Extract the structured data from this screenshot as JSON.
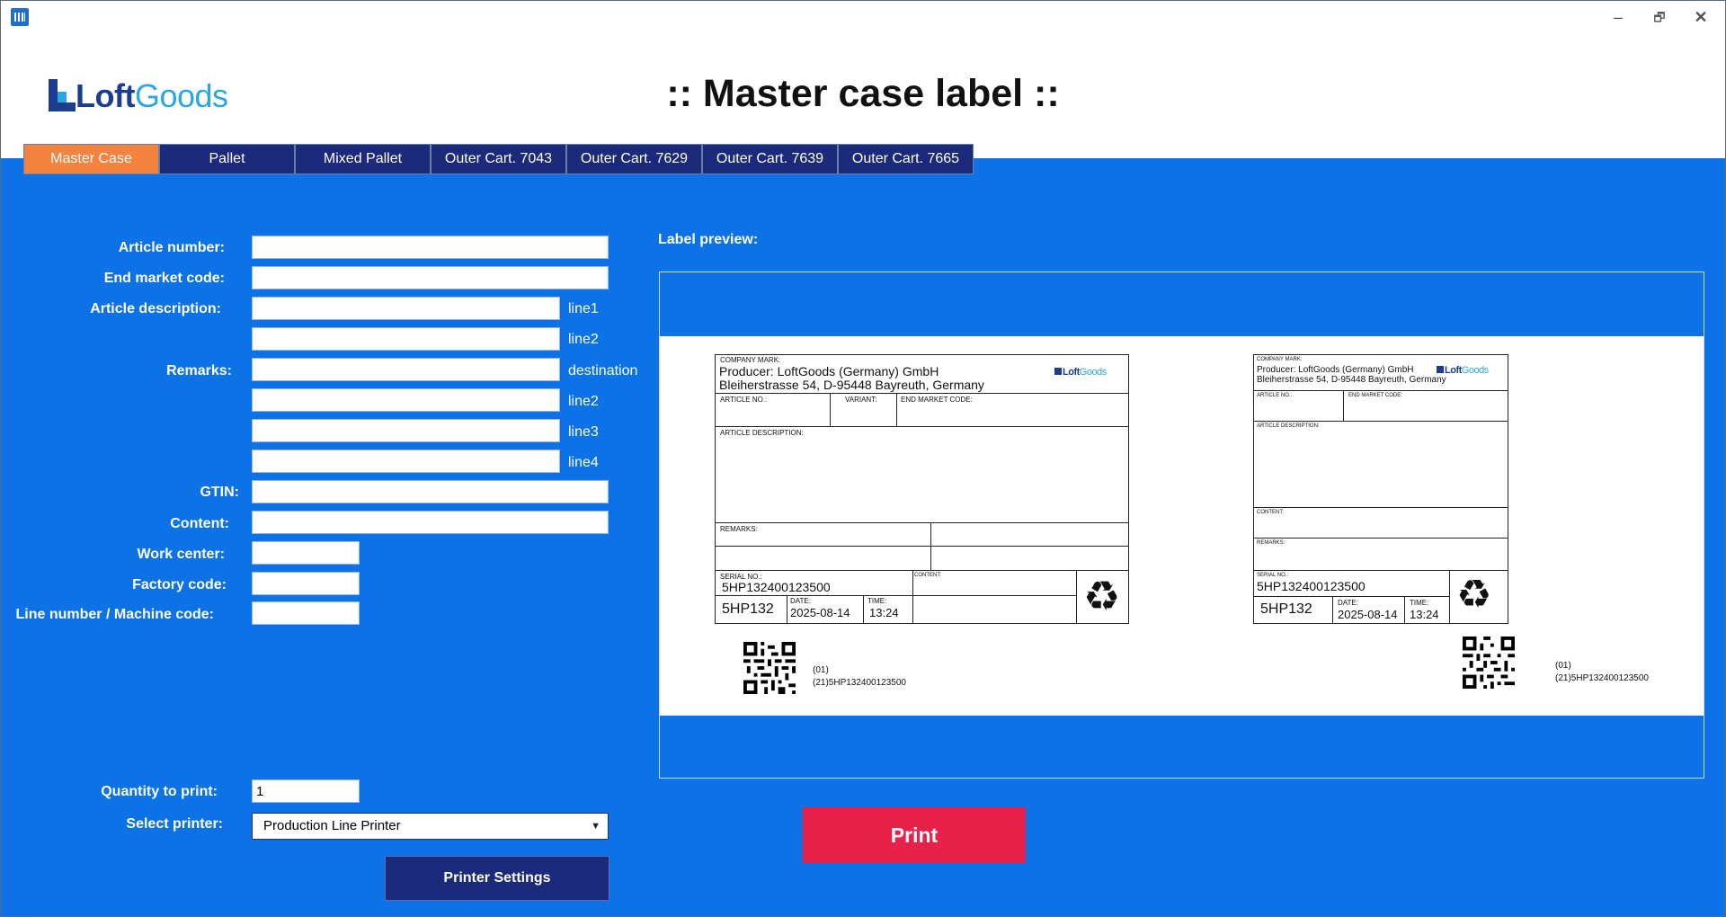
{
  "window": {
    "minimize": "–",
    "restore": "🗗",
    "close": "✕"
  },
  "brand": {
    "part1": "Loft",
    "part2": "Goods"
  },
  "page_title": ":: Master case label ::",
  "tabs": [
    "Master Case",
    "Pallet",
    "Mixed Pallet",
    "Outer Cart. 7043",
    "Outer Cart. 7629",
    "Outer Cart. 7639",
    "Outer Cart. 7665"
  ],
  "active_tab": "Master Case",
  "form": {
    "article_number": "Article number:",
    "end_market_code": "End market code:",
    "article_description": "Article description:",
    "remarks": "Remarks:",
    "gtin": "GTIN:",
    "content": "Content:",
    "work_center": "Work center:",
    "factory_code": "Factory code:",
    "line_number": "Line number / Machine code:",
    "quantity": "Quantity to print:",
    "quantity_value": "1",
    "select_printer": "Select printer:",
    "printer_value": "Production Line Printer"
  },
  "suffixes": {
    "line1": "line1",
    "line2a": "line2",
    "destination": "destination",
    "line2b": "line2",
    "line3": "line3",
    "line4": "line4"
  },
  "buttons": {
    "printer_settings": "Printer Settings",
    "print": "Print"
  },
  "preview": {
    "title": "Label preview:",
    "company_mark": "COMPANY MARK:",
    "producer": "Producer: LoftGoods (Germany) GmbH",
    "address": "Bleiherstrasse 54, D-95448 Bayreuth, Germany",
    "article_no": "ARTICLE NO.:",
    "variant": "VARIANT:",
    "end_market": "END MARKET CODE:",
    "article_desc": "ARTICLE DESCRIPTION:",
    "remarks": "REMARKS:",
    "serial_no": "SERIAL NO.:",
    "content": "CONTENT:",
    "serial_value": "5HP132400123500",
    "short_code": "5HP132",
    "date_label": "DATE:",
    "date_value": "2025-08-14",
    "time_label": "TIME:",
    "time_value": "13:24",
    "ai01": "(01)",
    "ai21": "(21)5HP132400123500"
  },
  "colors": {
    "accent": "#f3833f",
    "tab_bg": "#1b2a7a",
    "main_bg": "#0c72e6",
    "print_button": "#e8214b"
  }
}
